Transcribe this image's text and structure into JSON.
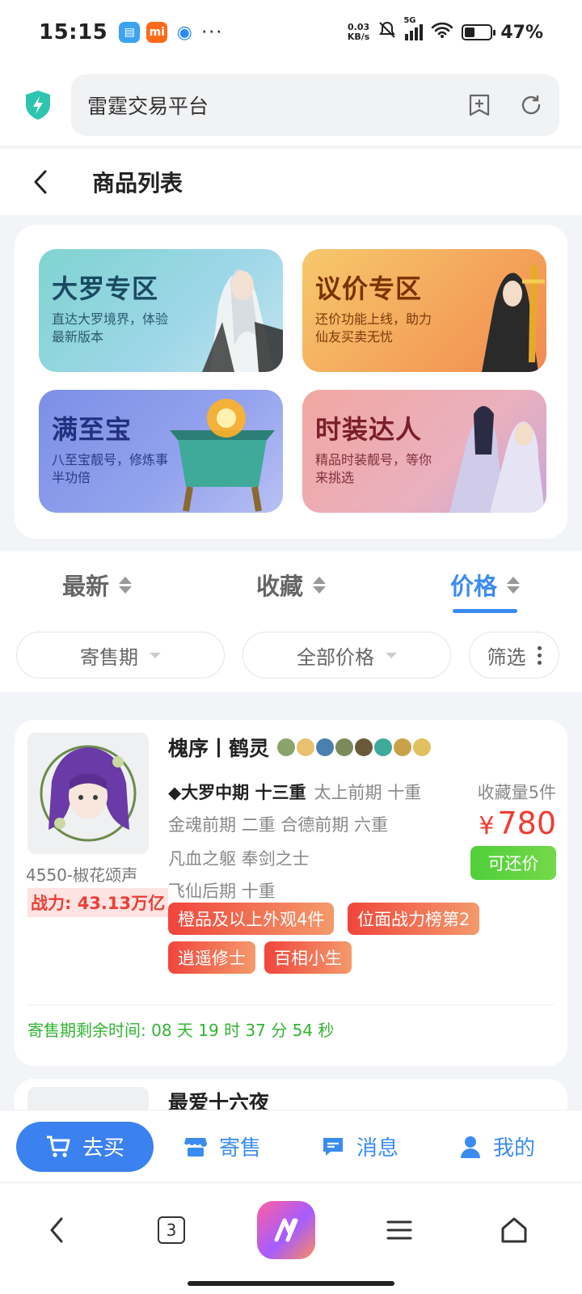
{
  "status": {
    "time": "15:15",
    "net_speed": "0.03",
    "net_unit": "KB/s",
    "signal": "5G",
    "battery": "47%"
  },
  "browser": {
    "url_title": "雷霆交易平台",
    "tab_count": "3"
  },
  "header": {
    "title": "商品列表"
  },
  "banners": [
    {
      "title": "大罗专区",
      "sub": "直达大罗境界，体验最新版本"
    },
    {
      "title": "议价专区",
      "sub": "还价功能上线，助力仙友买卖无忧"
    },
    {
      "title": "满至宝",
      "sub": "八至宝靓号，修炼事半功倍"
    },
    {
      "title": "时装达人",
      "sub": "精品时装靓号，等你来挑选"
    }
  ],
  "sort_tabs": [
    {
      "label": "最新"
    },
    {
      "label": "收藏"
    },
    {
      "label": "价格"
    }
  ],
  "filters": {
    "period": "寄售期",
    "price": "全部价格",
    "filter": "筛选"
  },
  "product": {
    "name": "槐序丨鹤灵",
    "seller": "4550-椒花颂声",
    "power": "战力: 43.13万亿",
    "realm_main": "◆大罗中期 十三重",
    "realm_2": "太上前期 十重",
    "realm_3": "金魂前期 二重 合德前期 六重",
    "realm_4": "凡血之躯 奉剑之士",
    "realm_5": "飞仙后期 十重",
    "fav": "收藏量5件",
    "currency": "¥",
    "price": "780",
    "bargain": "可还价",
    "tags": [
      "橙品及以上外观4件",
      "位面战力榜第2",
      "逍遥修士",
      "百相小生"
    ],
    "countdown": "寄售期剩余时间: 08 天 19 时 37 分 54 秒"
  },
  "product2": {
    "name": "最爱十六夜"
  },
  "tabbar": [
    {
      "label": "去买"
    },
    {
      "label": "寄售"
    },
    {
      "label": "消息"
    },
    {
      "label": "我的"
    }
  ],
  "colors": {
    "accent": "#3b8cf0",
    "price": "#f03c32",
    "bargain": "#4fcf3a",
    "countdown": "#33b333"
  }
}
